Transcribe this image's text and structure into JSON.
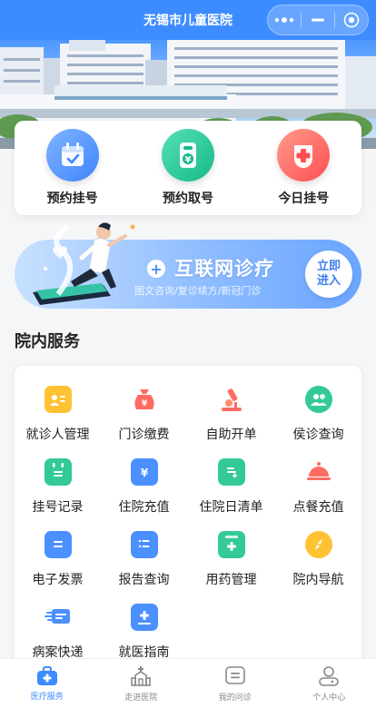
{
  "header": {
    "title": "无锡市儿童医院",
    "more_icon": "more-dots-icon",
    "minimize_icon": "minimize-icon",
    "close_icon": "target-close-icon"
  },
  "quick": [
    {
      "label": "预约挂号",
      "icon": "calendar-check-icon",
      "color": "#4a90ff"
    },
    {
      "label": "预约取号",
      "icon": "ticket-yen-icon",
      "color": "#1fc59a"
    },
    {
      "label": "今日挂号",
      "icon": "medical-cross-icon",
      "color": "#ff5a5a"
    }
  ],
  "net_banner": {
    "title": "互联网诊疗",
    "subtitle": "图文咨询/复诊续方/新冠门诊",
    "button": "立即进入",
    "button_line1": "立即",
    "button_line2": "进入"
  },
  "section": {
    "title": "院内服务"
  },
  "services": [
    {
      "label": "就诊人管理",
      "icon": "patient-card-icon",
      "color": "#ffc233"
    },
    {
      "label": "门诊缴费",
      "icon": "money-bag-icon",
      "color": "#ff6b61"
    },
    {
      "label": "自助开单",
      "icon": "microscope-icon",
      "color": "#ff6b61"
    },
    {
      "label": "侯诊查询",
      "icon": "users-group-icon",
      "color": "#33c999"
    },
    {
      "label": "挂号记录",
      "icon": "register-record-icon",
      "color": "#33c999"
    },
    {
      "label": "住院充值",
      "icon": "wallet-yen-icon",
      "color": "#4a90ff"
    },
    {
      "label": "住院日清单",
      "icon": "daily-list-icon",
      "color": "#33c999"
    },
    {
      "label": "点餐充值",
      "icon": "food-cloche-icon",
      "color": "#ff6b61"
    },
    {
      "label": "电子发票",
      "icon": "invoice-icon",
      "color": "#4a90ff"
    },
    {
      "label": "报告查询",
      "icon": "report-list-icon",
      "color": "#4a90ff"
    },
    {
      "label": "用药管理",
      "icon": "medicine-box-icon",
      "color": "#33c999"
    },
    {
      "label": "院内导航",
      "icon": "compass-icon",
      "color": "#ffc233"
    },
    {
      "label": "病案快递",
      "icon": "express-delivery-icon",
      "color": "#4a90ff"
    },
    {
      "label": "就医指南",
      "icon": "guide-book-icon",
      "color": "#4a90ff"
    }
  ],
  "tabs": [
    {
      "label": "医疗服务",
      "icon": "medical-kit-icon",
      "active": true
    },
    {
      "label": "走进医院",
      "icon": "hospital-building-icon",
      "active": false
    },
    {
      "label": "我的问诊",
      "icon": "chat-consult-icon",
      "active": false
    },
    {
      "label": "个人中心",
      "icon": "user-profile-icon",
      "active": false
    }
  ],
  "colors": {
    "primary": "#3d8cff",
    "active_tab": "#3d8cff",
    "inactive_tab": "#888888"
  }
}
